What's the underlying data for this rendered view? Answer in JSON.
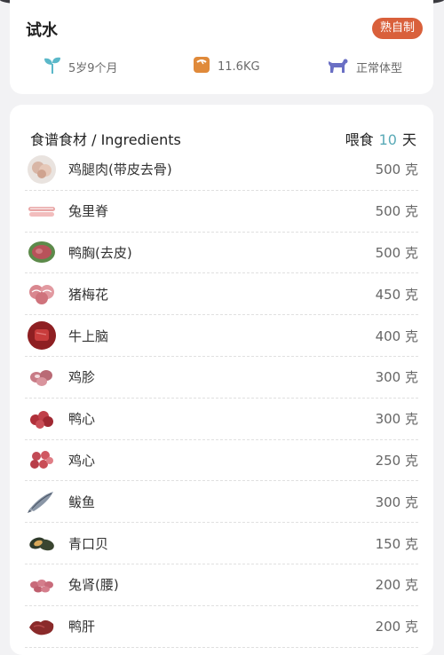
{
  "pet": {
    "name": "试水",
    "diet_badge": "熟自制",
    "age": "5岁9个月",
    "weight": "11.6KG",
    "body_type": "正常体型"
  },
  "colors": {
    "accent_orange": "#d9603b",
    "accent_teal": "#5aaab7",
    "underline_blue": "#6cc1d6",
    "sprout_icon": "#5bb8c9",
    "scale_icon": "#e08a3a",
    "dog_icon": "#6a6fc4"
  },
  "ingredients_section": {
    "title": "食谱食材 / Ingredients",
    "feed_prefix": "喂食",
    "feed_days": "10",
    "feed_suffix": "天",
    "items": [
      {
        "name": "鸡腿肉(带皮去骨)",
        "qty": "500 克",
        "icon": "chicken-thigh-icon"
      },
      {
        "name": "兔里脊",
        "qty": "500 克",
        "icon": "rabbit-loin-icon"
      },
      {
        "name": "鸭胸(去皮)",
        "qty": "500 克",
        "icon": "duck-breast-icon"
      },
      {
        "name": "猪梅花",
        "qty": "450 克",
        "icon": "pork-shoulder-icon"
      },
      {
        "name": "牛上脑",
        "qty": "400 克",
        "icon": "beef-chuck-icon"
      },
      {
        "name": "鸡胗",
        "qty": "300 克",
        "icon": "chicken-gizzard-icon"
      },
      {
        "name": "鸭心",
        "qty": "300 克",
        "icon": "duck-heart-icon"
      },
      {
        "name": "鸡心",
        "qty": "250 克",
        "icon": "chicken-heart-icon"
      },
      {
        "name": "鲅鱼",
        "qty": "300 克",
        "icon": "mackerel-icon"
      },
      {
        "name": "青口贝",
        "qty": "150 克",
        "icon": "mussel-icon"
      },
      {
        "name": "兔肾(腰)",
        "qty": "200 克",
        "icon": "rabbit-kidney-icon"
      },
      {
        "name": "鸭肝",
        "qty": "200 克",
        "icon": "duck-liver-icon"
      }
    ]
  }
}
